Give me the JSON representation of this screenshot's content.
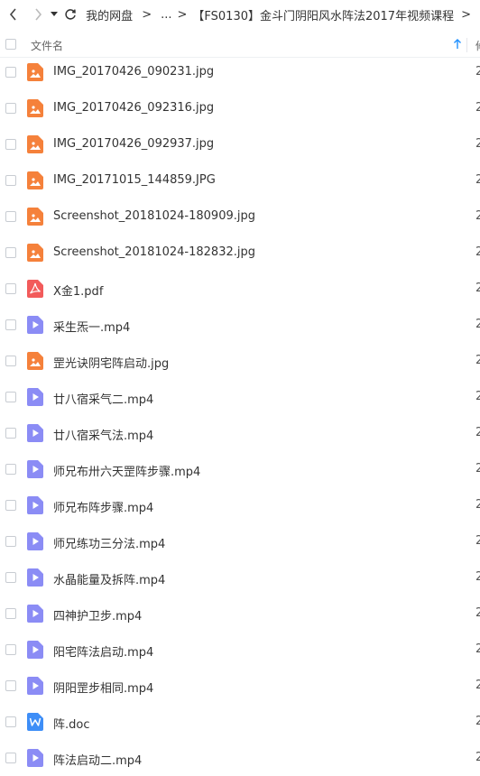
{
  "breadcrumb": {
    "root": "我的网盘",
    "ellipsis": "...",
    "current": "【FS0130】金斗门阴阳风水阵法2017年视频课程",
    "separator": ">"
  },
  "header": {
    "name_label": "文件名",
    "next_col_partial": "修"
  },
  "files": [
    {
      "name": "IMG_20170426_090231.jpg",
      "type": "image",
      "date": "2"
    },
    {
      "name": "IMG_20170426_092316.jpg",
      "type": "image",
      "date": "2"
    },
    {
      "name": "IMG_20170426_092937.jpg",
      "type": "image",
      "date": "2"
    },
    {
      "name": "IMG_20171015_144859.JPG",
      "type": "image",
      "date": "2"
    },
    {
      "name": "Screenshot_20181024-180909.jpg",
      "type": "image",
      "date": "2"
    },
    {
      "name": "Screenshot_20181024-182832.jpg",
      "type": "image",
      "date": "2"
    },
    {
      "name": "X金1.pdf",
      "type": "pdf",
      "date": "2"
    },
    {
      "name": "采生炁一.mp4",
      "type": "video",
      "date": "2"
    },
    {
      "name": "罡光诀阴宅阵启动.jpg",
      "type": "image",
      "date": "2"
    },
    {
      "name": "廿八宿采气二.mp4",
      "type": "video",
      "date": "2"
    },
    {
      "name": "廿八宿采气法.mp4",
      "type": "video",
      "date": "2"
    },
    {
      "name": "师兄布卅六天罡阵步骤.mp4",
      "type": "video",
      "date": "2"
    },
    {
      "name": "师兄布阵步骤.mp4",
      "type": "video",
      "date": "2"
    },
    {
      "name": "师兄练功三分法.mp4",
      "type": "video",
      "date": "2"
    },
    {
      "name": "水晶能量及拆阵.mp4",
      "type": "video",
      "date": "2"
    },
    {
      "name": "四神护卫步.mp4",
      "type": "video",
      "date": "2"
    },
    {
      "name": "阳宅阵法启动.mp4",
      "type": "video",
      "date": "2"
    },
    {
      "name": "阴阳罡步相同.mp4",
      "type": "video",
      "date": "2"
    },
    {
      "name": "阵.doc",
      "type": "doc",
      "date": "2"
    },
    {
      "name": "阵法启动二.mp4",
      "type": "video",
      "date": "2"
    }
  ],
  "colors": {
    "image": "#f5813b",
    "pdf": "#f25b5b",
    "video": "#8b8cf5",
    "doc": "#3e8ef7",
    "sort_arrow": "#1e90ff"
  }
}
